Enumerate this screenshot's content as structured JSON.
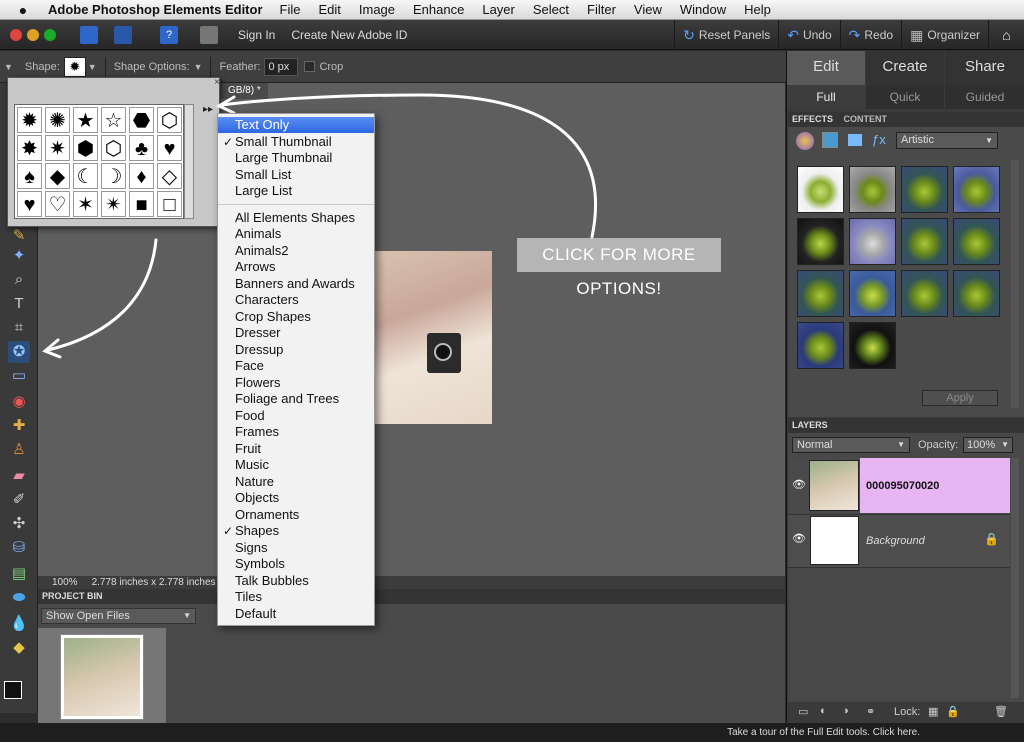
{
  "menubar": {
    "apple": "",
    "app_name": "Adobe Photoshop Elements Editor",
    "items": [
      "File",
      "Edit",
      "Image",
      "Enhance",
      "Layer",
      "Select",
      "Filter",
      "View",
      "Window",
      "Help"
    ]
  },
  "appbar": {
    "sign_in": "Sign In",
    "create_id": "Create New Adobe ID",
    "reset_panels": "Reset Panels",
    "undo": "Undo",
    "redo": "Redo",
    "organizer": "Organizer"
  },
  "options": {
    "shape_label": "Shape:",
    "shape_options_label": "Shape Options:",
    "feather_label": "Feather:",
    "feather_value": "0 px",
    "crop_label": "Crop"
  },
  "document": {
    "tab_title": "GB/8) *",
    "zoom": "100%",
    "size_info": "2.778 inches x 2.778 inches ("
  },
  "project_bin": {
    "header": "PROJECT BIN",
    "select_value": "Show Open Files"
  },
  "modes": {
    "tabs": [
      "Edit",
      "Create",
      "Share"
    ],
    "subtabs": [
      "Full",
      "Quick",
      "Guided"
    ]
  },
  "effects": {
    "header_tabs": [
      "EFFECTS",
      "CONTENT"
    ],
    "filter_value": "Artistic",
    "apply_label": "Apply"
  },
  "layers": {
    "header": "LAYERS",
    "blend_mode": "Normal",
    "opacity_label": "Opacity:",
    "opacity_value": "100%",
    "items": [
      {
        "name": "000095070020"
      },
      {
        "name": "Background"
      }
    ],
    "lock_label": "Lock:"
  },
  "footer": "Take a tour of the Full Edit tools. Click here.",
  "annotation": "CLICK FOR MORE OPTIONS!",
  "shape_menu": {
    "view_items": [
      {
        "label": "Text Only",
        "highlighted": true
      },
      {
        "label": "Small Thumbnail",
        "checked": true
      },
      {
        "label": "Large Thumbnail"
      },
      {
        "label": "Small List"
      },
      {
        "label": "Large List"
      }
    ],
    "library_items": [
      {
        "label": "All Elements Shapes"
      },
      {
        "label": "Animals"
      },
      {
        "label": "Animals2"
      },
      {
        "label": "Arrows"
      },
      {
        "label": "Banners and Awards"
      },
      {
        "label": "Characters"
      },
      {
        "label": "Crop Shapes"
      },
      {
        "label": "Dresser"
      },
      {
        "label": "Dressup"
      },
      {
        "label": "Face"
      },
      {
        "label": "Flowers"
      },
      {
        "label": "Foliage and Trees"
      },
      {
        "label": "Food"
      },
      {
        "label": "Frames"
      },
      {
        "label": "Fruit"
      },
      {
        "label": "Music"
      },
      {
        "label": "Nature"
      },
      {
        "label": "Objects"
      },
      {
        "label": "Ornaments"
      },
      {
        "label": "Shapes",
        "checked": true
      },
      {
        "label": "Signs"
      },
      {
        "label": "Symbols"
      },
      {
        "label": "Talk Bubbles"
      },
      {
        "label": "Tiles"
      },
      {
        "label": "Default"
      }
    ]
  },
  "shape_grid": [
    "✹",
    "✺",
    "★",
    "☆",
    "⬣",
    "⬡",
    "✸",
    "✷",
    "⬢",
    "⬡",
    "♣",
    "♥",
    "♠",
    "◆",
    "☾",
    "☽",
    "♦",
    "◇",
    "♥",
    "♡",
    "✶",
    "✴",
    "■",
    "□"
  ]
}
